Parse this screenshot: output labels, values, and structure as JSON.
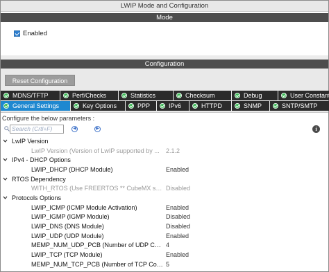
{
  "window": {
    "title": "LWIP Mode and Configuration"
  },
  "mode": {
    "header": "Mode",
    "enabled_label": "Enabled",
    "enabled_checked": true
  },
  "configuration": {
    "header": "Configuration",
    "reset_button": "Reset Configuration",
    "tabs_row1": [
      {
        "label": "MDNS/TFTP",
        "icon": "check-circle-icon"
      },
      {
        "label": "Perf/Checks",
        "icon": "check-circle-icon"
      },
      {
        "label": "Statistics",
        "icon": "check-circle-icon"
      },
      {
        "label": "Checksum",
        "icon": "check-circle-icon"
      },
      {
        "label": "Debug",
        "icon": "check-circle-icon"
      },
      {
        "label": "User Constants",
        "icon": "check-circle-icon"
      }
    ],
    "tabs_row2": [
      {
        "label": "General Settings",
        "icon": "check-circle-icon",
        "active": true
      },
      {
        "label": "Key Options",
        "icon": "check-circle-icon"
      },
      {
        "label": "PPP",
        "icon": "check-circle-icon"
      },
      {
        "label": "IPv6",
        "icon": "check-circle-icon"
      },
      {
        "label": "HTTPD",
        "icon": "check-circle-icon"
      },
      {
        "label": "SNMP",
        "icon": "check-circle-icon"
      },
      {
        "label": "SNTP/SMTP",
        "icon": "check-circle-icon"
      }
    ],
    "configure_label": "Configure the below parameters :",
    "search_placeholder": "Search (Crtl+F)",
    "groups": [
      {
        "name": "LwIP Version",
        "params": [
          {
            "name": "LwIP Version (Version of LwIP supported by ...",
            "value": "2.1.2",
            "disabled": true
          }
        ]
      },
      {
        "name": "IPv4 - DHCP Options",
        "params": [
          {
            "name": "LWIP_DHCP (DHCP Module)",
            "value": "Enabled",
            "disabled": false
          }
        ]
      },
      {
        "name": "RTOS Dependency",
        "params": [
          {
            "name": "WITH_RTOS (Use FREERTOS ** CubeMX sp...",
            "value": "Disabled",
            "disabled": true
          }
        ]
      },
      {
        "name": "Protocols Options",
        "params": [
          {
            "name": "LWIP_ICMP (ICMP Module Activation)",
            "value": "Enabled",
            "disabled": false
          },
          {
            "name": "LWIP_IGMP (IGMP Module)",
            "value": "Disabled",
            "disabled": false
          },
          {
            "name": "LWIP_DNS (DNS Module)",
            "value": "Disabled",
            "disabled": false
          },
          {
            "name": "LWIP_UDP (UDP Module)",
            "value": "Enabled",
            "disabled": false
          },
          {
            "name": "MEMP_NUM_UDP_PCB (Number of UDP Co...",
            "value": "4",
            "disabled": false
          },
          {
            "name": "LWIP_TCP (TCP Module)",
            "value": "Enabled",
            "disabled": false
          },
          {
            "name": "MEMP_NUM_TCP_PCB (Number of TCP Con...",
            "value": "5",
            "disabled": false
          }
        ]
      }
    ]
  }
}
